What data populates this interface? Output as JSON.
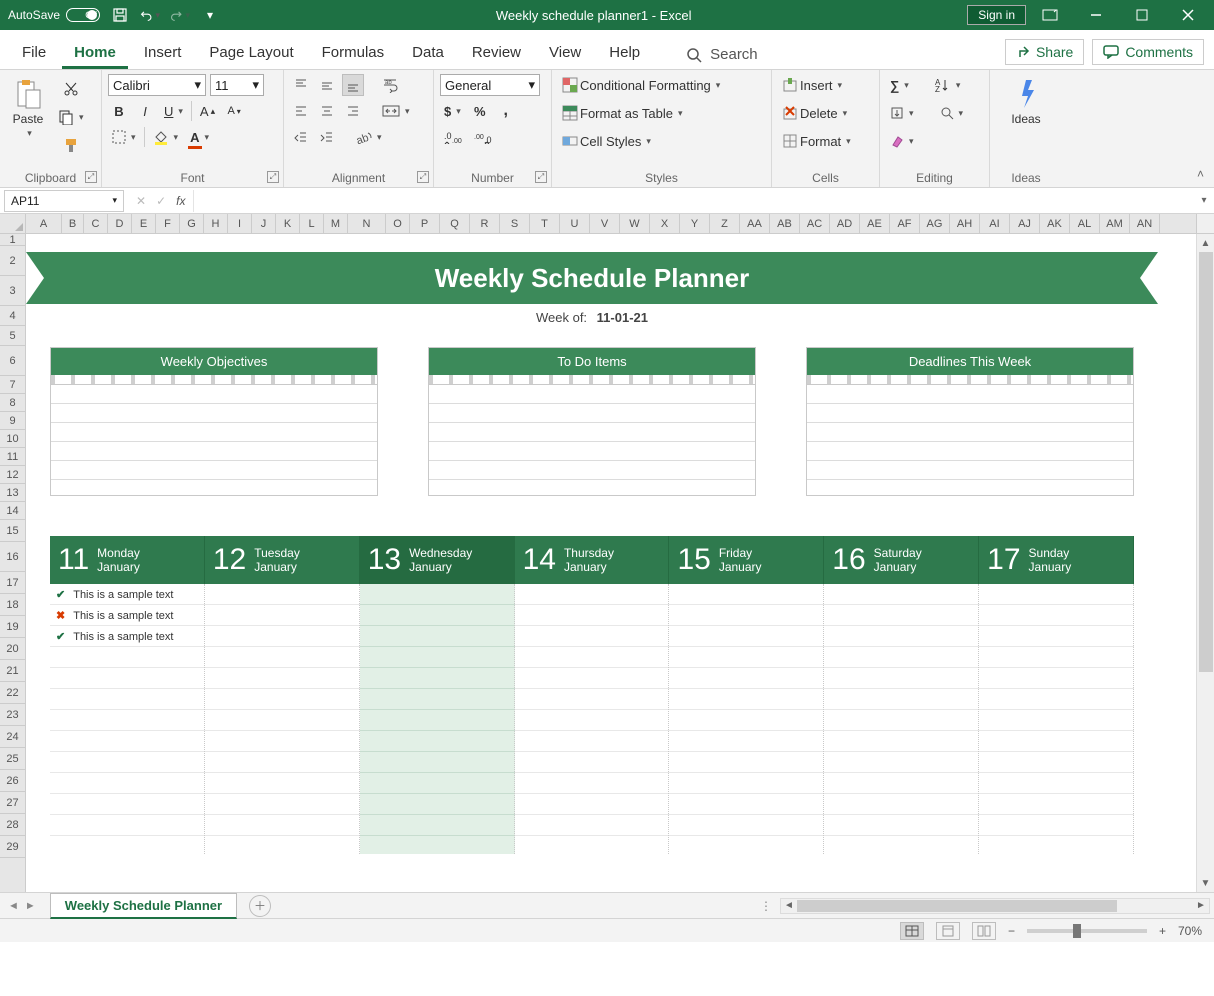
{
  "titlebar": {
    "autosave": "AutoSave",
    "autosave_state": "Off",
    "title": "Weekly schedule planner1  -  Excel",
    "signin": "Sign in"
  },
  "tabs": {
    "file": "File",
    "home": "Home",
    "insert": "Insert",
    "pagelayout": "Page Layout",
    "formulas": "Formulas",
    "data": "Data",
    "review": "Review",
    "view": "View",
    "help": "Help",
    "search": "Search",
    "share": "Share",
    "comments": "Comments"
  },
  "ribbon": {
    "clipboard": {
      "paste": "Paste",
      "title": "Clipboard"
    },
    "font": {
      "name": "Calibri",
      "size": "11",
      "title": "Font"
    },
    "alignment": {
      "title": "Alignment"
    },
    "number": {
      "format": "General",
      "title": "Number"
    },
    "styles": {
      "cond": "Conditional Formatting",
      "table": "Format as Table",
      "cell": "Cell Styles",
      "title": "Styles"
    },
    "cells": {
      "insert": "Insert",
      "delete": "Delete",
      "format": "Format",
      "title": "Cells"
    },
    "editing": {
      "title": "Editing"
    },
    "ideas": {
      "label": "Ideas",
      "title": "Ideas"
    }
  },
  "fbar": {
    "name": "AP11"
  },
  "columns": [
    "A",
    "B",
    "C",
    "D",
    "E",
    "F",
    "G",
    "H",
    "I",
    "J",
    "K",
    "L",
    "M",
    "N",
    "O",
    "P",
    "Q",
    "R",
    "S",
    "T",
    "U",
    "V",
    "W",
    "X",
    "Y",
    "Z",
    "AA",
    "AB",
    "AC",
    "AD",
    "AE",
    "AF",
    "AG",
    "AH",
    "AI",
    "AJ",
    "AK",
    "AL",
    "AM",
    "AN"
  ],
  "rows": [
    "1",
    "2",
    "3",
    "4",
    "5",
    "6",
    "7",
    "8",
    "9",
    "10",
    "11",
    "12",
    "13",
    "14",
    "15",
    "16",
    "17",
    "18",
    "19",
    "20",
    "21",
    "22",
    "23",
    "24",
    "25",
    "26",
    "27",
    "28",
    "29"
  ],
  "planner": {
    "title": "Weekly Schedule Planner",
    "weekof_label": "Week of:",
    "weekof_value": "11-01-21",
    "cards": {
      "objectives": "Weekly Objectives",
      "todo": "To Do Items",
      "deadlines": "Deadlines This Week"
    },
    "days": [
      {
        "num": "11",
        "dow": "Monday",
        "mon": "January"
      },
      {
        "num": "12",
        "dow": "Tuesday",
        "mon": "January"
      },
      {
        "num": "13",
        "dow": "Wednesday",
        "mon": "January"
      },
      {
        "num": "14",
        "dow": "Thursday",
        "mon": "January"
      },
      {
        "num": "15",
        "dow": "Friday",
        "mon": "January"
      },
      {
        "num": "16",
        "dow": "Saturday",
        "mon": "January"
      },
      {
        "num": "17",
        "dow": "Sunday",
        "mon": "January"
      }
    ],
    "tasks": [
      {
        "mark": "✔",
        "text": "This is a sample text"
      },
      {
        "mark": "✖",
        "text": "This is a sample text"
      },
      {
        "mark": "✔",
        "text": "This is a sample text"
      }
    ]
  },
  "sheettab": "Weekly Schedule Planner",
  "status": {
    "zoom": "70%"
  }
}
